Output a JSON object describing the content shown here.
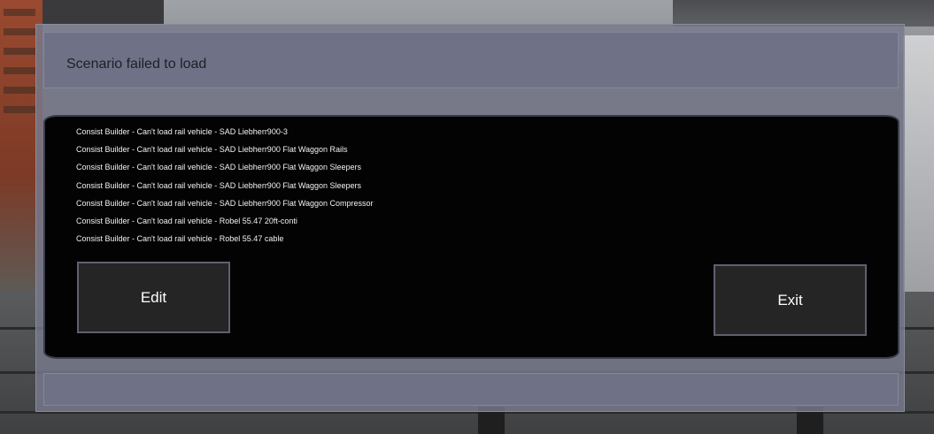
{
  "dialog": {
    "title": "Scenario failed to load",
    "messages": [
      "Consist Builder - Can't load rail vehicle - SAD Liebherr900-3",
      "Consist Builder - Can't load rail vehicle - SAD Liebherr900 Flat Waggon Rails",
      "Consist Builder - Can't load rail vehicle - SAD Liebherr900 Flat Waggon Sleepers",
      "Consist Builder - Can't load rail vehicle - SAD Liebherr900 Flat Waggon Sleepers",
      "Consist Builder - Can't load rail vehicle - SAD Liebherr900 Flat Waggon Compressor",
      "Consist Builder - Can't load rail vehicle - Robel 55.47 20ft-conti",
      "Consist Builder - Can't load rail vehicle - Robel 55.47 cable"
    ],
    "edit_label": "Edit",
    "exit_label": "Exit"
  },
  "colors": {
    "panel": "#6f7187",
    "message_background": "#030304",
    "button_background": "#252525",
    "message_text": "#f2f2f2"
  }
}
